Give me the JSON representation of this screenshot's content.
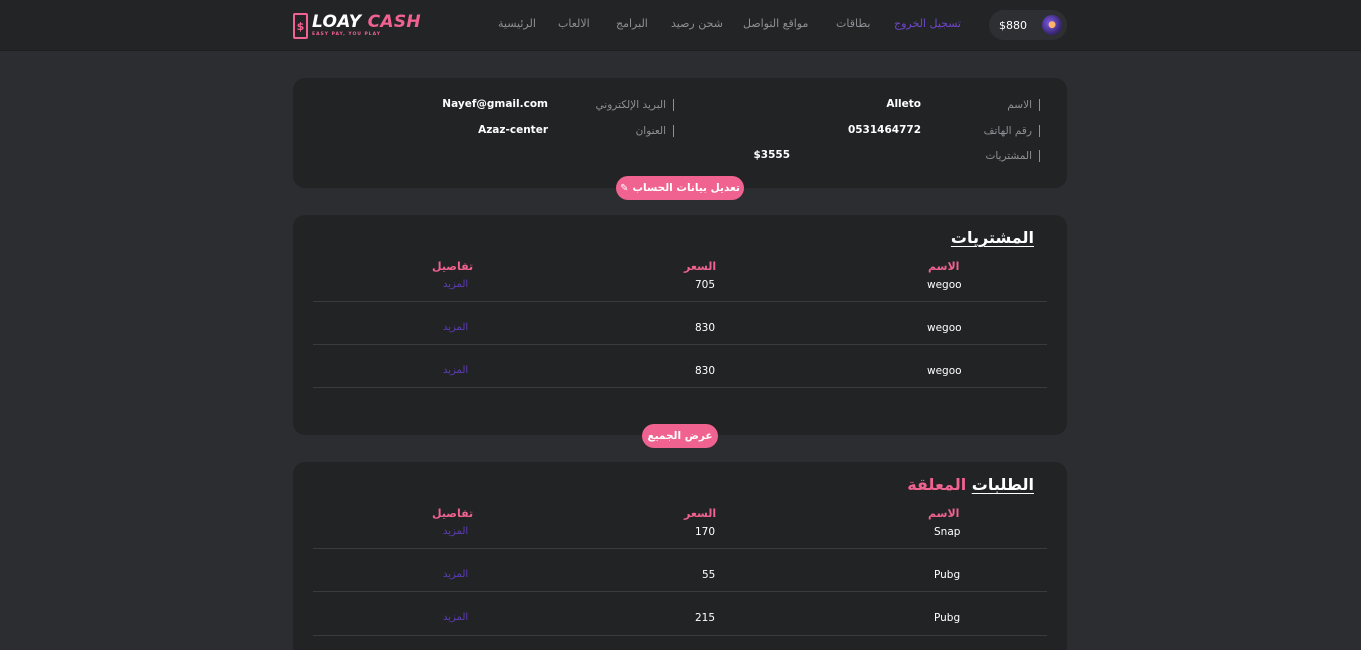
{
  "header": {
    "logo_title_white": "LOAY",
    "logo_title_pink": "CASH",
    "logo_tagline": "EASY PAY, YOU PLAY",
    "nav": [
      {
        "label": "الرئيسية",
        "active": false
      },
      {
        "label": "الالعاب",
        "active": false
      },
      {
        "label": "البرامج",
        "active": false
      },
      {
        "label": "شحن رصيد",
        "active": false
      },
      {
        "label": "مواقع التواصل",
        "active": false
      },
      {
        "label": "بطاقات",
        "active": false
      },
      {
        "label": "تسجيل الخروج",
        "active": true
      }
    ],
    "balance": "$880",
    "avatar_icon": "gamer-avatar-icon"
  },
  "account": {
    "name_label": "الاسم",
    "name_value": "Alleto",
    "phone_label": "رقم الهاتف",
    "phone_value": "0531464772",
    "purchases_label": "المشتريات",
    "purchases_value": "$3555",
    "email_label": "البريد الإلكتروني",
    "email_value": "Nayef@gmail.com",
    "address_label": "العنوان",
    "address_value": "Azaz-center",
    "edit_button": "تعديل بيانات الحساب"
  },
  "purchases": {
    "title": "المشتريات",
    "columns": {
      "name": "الاسم",
      "price": "السعر",
      "details": "تفاصيل"
    },
    "rows": [
      {
        "name": "wegoo",
        "price": "705",
        "details": "المزيد"
      },
      {
        "name": "wegoo",
        "price": "830",
        "details": "المزيد"
      },
      {
        "name": "wegoo",
        "price": "830",
        "details": "المزيد"
      }
    ],
    "view_all_button": "عرض الجميع"
  },
  "pending": {
    "title_main": "الطلبات",
    "title_accent": "المعلقة",
    "columns": {
      "name": "الاسم",
      "price": "السعر",
      "details": "تفاصيل"
    },
    "rows": [
      {
        "name": "Snap",
        "price": "170",
        "details": "المزيد"
      },
      {
        "name": "Pubg",
        "price": "55",
        "details": "المزيد"
      },
      {
        "name": "Pubg",
        "price": "215",
        "details": "المزيد"
      }
    ]
  },
  "colors": {
    "accent_pink": "#f0628f",
    "accent_purple": "#6f46c9",
    "background": "#2c2d30",
    "card": "#222325"
  }
}
